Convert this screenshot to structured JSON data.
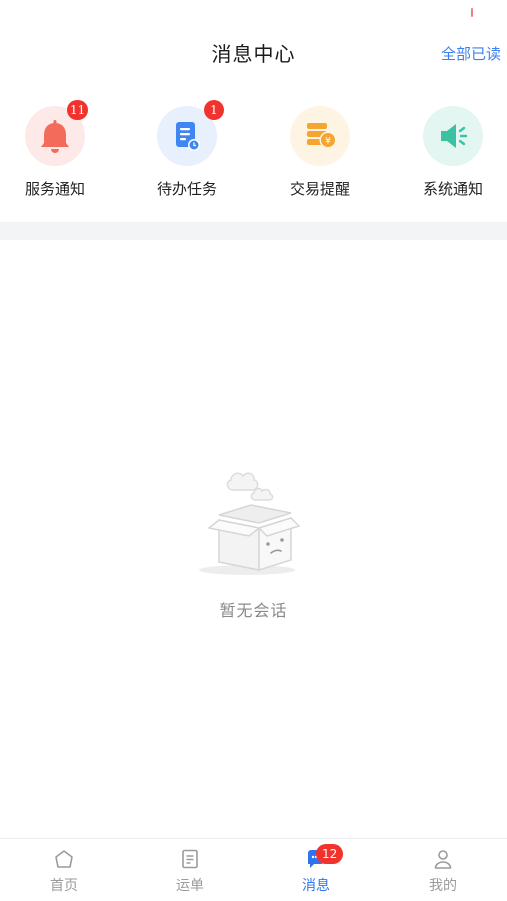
{
  "header": {
    "title": "消息中心",
    "mark_all_read": "全部已读"
  },
  "shortcuts": [
    {
      "label": "服务通知",
      "icon": "bell-icon",
      "badge": "11",
      "color": "#f26b5b",
      "bg": "#fde9e8"
    },
    {
      "label": "待办任务",
      "icon": "task-document-icon",
      "badge": "1",
      "color": "#3f86f2",
      "bg": "#e8f0fe"
    },
    {
      "label": "交易提醒",
      "icon": "coins-icon",
      "badge": "",
      "color": "#f6a531",
      "bg": "#fef4e4"
    },
    {
      "label": "系统通知",
      "icon": "speaker-icon",
      "badge": "",
      "color": "#3cc1a3",
      "bg": "#e4f6f1"
    }
  ],
  "empty_state": {
    "text": "暂无会话",
    "icon": "empty-box-icon"
  },
  "tabbar": {
    "tabs": [
      {
        "label": "首页",
        "icon": "home-icon",
        "active": false
      },
      {
        "label": "运单",
        "icon": "waybill-icon",
        "active": false
      },
      {
        "label": "消息",
        "icon": "message-icon",
        "active": true,
        "badge": "12"
      },
      {
        "label": "我的",
        "icon": "profile-icon",
        "active": false
      }
    ]
  },
  "colors": {
    "accent": "#2f74ee",
    "badge": "#f2332d",
    "band": "#f3f4f6"
  }
}
